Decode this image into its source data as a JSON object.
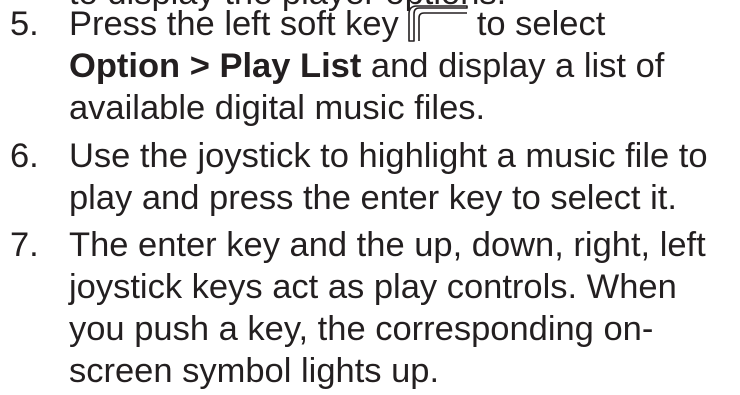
{
  "partial_top_line": "to display the player options.",
  "steps": [
    {
      "number": "5.",
      "line1_before_icon": "Press the left soft key",
      "line1_after_icon": "to select",
      "line2_bold": "Option > Play List",
      "line2_rest": " and display a list of",
      "line3": "available digital music files."
    },
    {
      "number": "6.",
      "line1": "Use the joystick to highlight a music file to",
      "line2": "play and press the enter key to select it."
    },
    {
      "number": "7.",
      "line1": "The enter key and the up, down, right, left",
      "line2": "joystick keys act as play controls. When",
      "line3": "you push a key, the corresponding on-",
      "line4": "screen symbol lights up."
    }
  ],
  "icons": {
    "left_soft_key": "left-soft-key-icon"
  }
}
